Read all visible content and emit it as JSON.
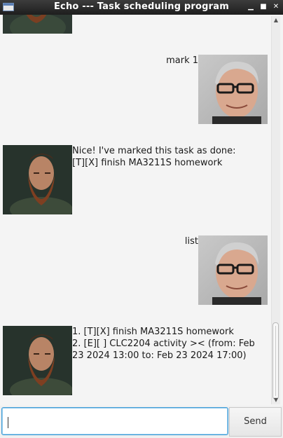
{
  "window": {
    "title": "Echo --- Task scheduling program",
    "controls": [
      "minimize-icon",
      "maximize-icon",
      "close-icon"
    ]
  },
  "conversation": {
    "messages": [
      {
        "sender": "user",
        "text": "mark 1"
      },
      {
        "sender": "bot",
        "lines": [
          "Nice! I've marked this task as done:",
          "[T][X] finish MA3211S homework"
        ]
      },
      {
        "sender": "user",
        "text": "list"
      },
      {
        "sender": "bot",
        "lines": [
          "1. [T][X] finish MA3211S homework",
          "2. [E][ ] CLC2204 activity >< (from: Feb",
          "23 2024 13:00 to: Feb 23 2024 17:00)"
        ]
      }
    ]
  },
  "input": {
    "value": "",
    "placeholder": ""
  },
  "send_button": {
    "label": "Send"
  },
  "colors": {
    "titlebar": "#2a2a2a",
    "background": "#f4f4f4",
    "input_focus": "#3c9bd6"
  }
}
